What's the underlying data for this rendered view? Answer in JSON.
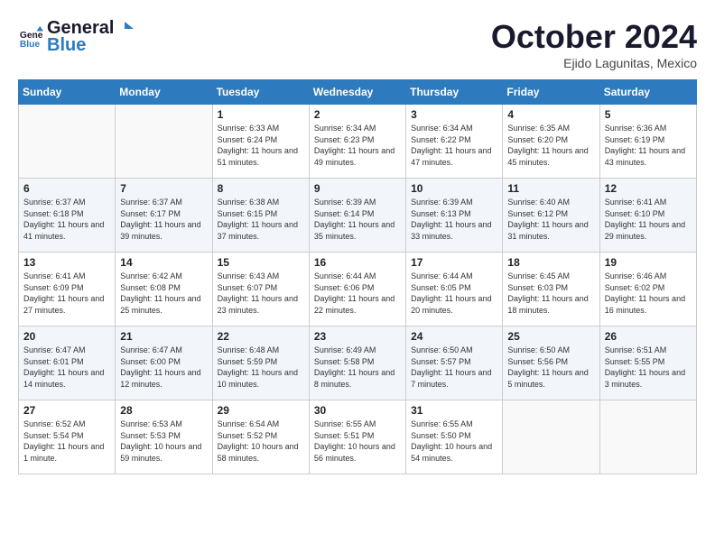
{
  "header": {
    "logo_line1": "General",
    "logo_line2": "Blue",
    "month": "October 2024",
    "location": "Ejido Lagunitas, Mexico"
  },
  "days_of_week": [
    "Sunday",
    "Monday",
    "Tuesday",
    "Wednesday",
    "Thursday",
    "Friday",
    "Saturday"
  ],
  "weeks": [
    [
      {
        "day": "",
        "detail": ""
      },
      {
        "day": "",
        "detail": ""
      },
      {
        "day": "1",
        "detail": "Sunrise: 6:33 AM\nSunset: 6:24 PM\nDaylight: 11 hours and 51 minutes."
      },
      {
        "day": "2",
        "detail": "Sunrise: 6:34 AM\nSunset: 6:23 PM\nDaylight: 11 hours and 49 minutes."
      },
      {
        "day": "3",
        "detail": "Sunrise: 6:34 AM\nSunset: 6:22 PM\nDaylight: 11 hours and 47 minutes."
      },
      {
        "day": "4",
        "detail": "Sunrise: 6:35 AM\nSunset: 6:20 PM\nDaylight: 11 hours and 45 minutes."
      },
      {
        "day": "5",
        "detail": "Sunrise: 6:36 AM\nSunset: 6:19 PM\nDaylight: 11 hours and 43 minutes."
      }
    ],
    [
      {
        "day": "6",
        "detail": "Sunrise: 6:37 AM\nSunset: 6:18 PM\nDaylight: 11 hours and 41 minutes."
      },
      {
        "day": "7",
        "detail": "Sunrise: 6:37 AM\nSunset: 6:17 PM\nDaylight: 11 hours and 39 minutes."
      },
      {
        "day": "8",
        "detail": "Sunrise: 6:38 AM\nSunset: 6:15 PM\nDaylight: 11 hours and 37 minutes."
      },
      {
        "day": "9",
        "detail": "Sunrise: 6:39 AM\nSunset: 6:14 PM\nDaylight: 11 hours and 35 minutes."
      },
      {
        "day": "10",
        "detail": "Sunrise: 6:39 AM\nSunset: 6:13 PM\nDaylight: 11 hours and 33 minutes."
      },
      {
        "day": "11",
        "detail": "Sunrise: 6:40 AM\nSunset: 6:12 PM\nDaylight: 11 hours and 31 minutes."
      },
      {
        "day": "12",
        "detail": "Sunrise: 6:41 AM\nSunset: 6:10 PM\nDaylight: 11 hours and 29 minutes."
      }
    ],
    [
      {
        "day": "13",
        "detail": "Sunrise: 6:41 AM\nSunset: 6:09 PM\nDaylight: 11 hours and 27 minutes."
      },
      {
        "day": "14",
        "detail": "Sunrise: 6:42 AM\nSunset: 6:08 PM\nDaylight: 11 hours and 25 minutes."
      },
      {
        "day": "15",
        "detail": "Sunrise: 6:43 AM\nSunset: 6:07 PM\nDaylight: 11 hours and 23 minutes."
      },
      {
        "day": "16",
        "detail": "Sunrise: 6:44 AM\nSunset: 6:06 PM\nDaylight: 11 hours and 22 minutes."
      },
      {
        "day": "17",
        "detail": "Sunrise: 6:44 AM\nSunset: 6:05 PM\nDaylight: 11 hours and 20 minutes."
      },
      {
        "day": "18",
        "detail": "Sunrise: 6:45 AM\nSunset: 6:03 PM\nDaylight: 11 hours and 18 minutes."
      },
      {
        "day": "19",
        "detail": "Sunrise: 6:46 AM\nSunset: 6:02 PM\nDaylight: 11 hours and 16 minutes."
      }
    ],
    [
      {
        "day": "20",
        "detail": "Sunrise: 6:47 AM\nSunset: 6:01 PM\nDaylight: 11 hours and 14 minutes."
      },
      {
        "day": "21",
        "detail": "Sunrise: 6:47 AM\nSunset: 6:00 PM\nDaylight: 11 hours and 12 minutes."
      },
      {
        "day": "22",
        "detail": "Sunrise: 6:48 AM\nSunset: 5:59 PM\nDaylight: 11 hours and 10 minutes."
      },
      {
        "day": "23",
        "detail": "Sunrise: 6:49 AM\nSunset: 5:58 PM\nDaylight: 11 hours and 8 minutes."
      },
      {
        "day": "24",
        "detail": "Sunrise: 6:50 AM\nSunset: 5:57 PM\nDaylight: 11 hours and 7 minutes."
      },
      {
        "day": "25",
        "detail": "Sunrise: 6:50 AM\nSunset: 5:56 PM\nDaylight: 11 hours and 5 minutes."
      },
      {
        "day": "26",
        "detail": "Sunrise: 6:51 AM\nSunset: 5:55 PM\nDaylight: 11 hours and 3 minutes."
      }
    ],
    [
      {
        "day": "27",
        "detail": "Sunrise: 6:52 AM\nSunset: 5:54 PM\nDaylight: 11 hours and 1 minute."
      },
      {
        "day": "28",
        "detail": "Sunrise: 6:53 AM\nSunset: 5:53 PM\nDaylight: 10 hours and 59 minutes."
      },
      {
        "day": "29",
        "detail": "Sunrise: 6:54 AM\nSunset: 5:52 PM\nDaylight: 10 hours and 58 minutes."
      },
      {
        "day": "30",
        "detail": "Sunrise: 6:55 AM\nSunset: 5:51 PM\nDaylight: 10 hours and 56 minutes."
      },
      {
        "day": "31",
        "detail": "Sunrise: 6:55 AM\nSunset: 5:50 PM\nDaylight: 10 hours and 54 minutes."
      },
      {
        "day": "",
        "detail": ""
      },
      {
        "day": "",
        "detail": ""
      }
    ]
  ]
}
